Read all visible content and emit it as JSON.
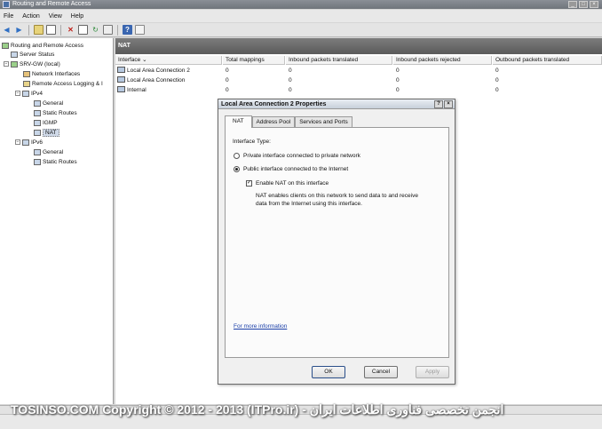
{
  "window": {
    "title": "Routing and Remote Access"
  },
  "menu": [
    "File",
    "Action",
    "View",
    "Help"
  ],
  "toolbar": {
    "icons": [
      "back-icon",
      "forward-icon",
      "up-icon",
      "properties-icon",
      "delete-icon",
      "export-icon",
      "refresh-icon",
      "help-icon",
      "console-icon"
    ]
  },
  "tree": {
    "items": [
      {
        "label": "Routing and Remote Access"
      },
      {
        "label": "Server Status"
      },
      {
        "label": "SRV-GW (local)"
      },
      {
        "label": "Network Interfaces"
      },
      {
        "label": "Remote Access Logging & I"
      },
      {
        "label": "IPv4"
      },
      {
        "label": "General"
      },
      {
        "label": "Static Routes"
      },
      {
        "label": "IGMP"
      },
      {
        "label": "NAT"
      },
      {
        "label": "IPv6"
      },
      {
        "label": "General"
      },
      {
        "label": "Static Routes"
      }
    ]
  },
  "nat": {
    "heading": "NAT",
    "columns": [
      "Interface",
      "Total mappings",
      "Inbound packets translated",
      "Inbound packets rejected",
      "Outbound packets translated"
    ],
    "rows": [
      {
        "name": "Local Area Connection 2",
        "total": "0",
        "in_trans": "0",
        "in_rej": "0",
        "out_trans": "0"
      },
      {
        "name": "Local Area Connection",
        "total": "0",
        "in_trans": "0",
        "in_rej": "0",
        "out_trans": "0"
      },
      {
        "name": "Internal",
        "total": "0",
        "in_trans": "0",
        "in_rej": "0",
        "out_trans": "0"
      }
    ]
  },
  "dialog": {
    "title": "Local Area Connection 2 Properties",
    "tabs": [
      "NAT",
      "Address Pool",
      "Services and Ports"
    ],
    "interface_type_label": "Interface Type:",
    "radio_private": "Private interface connected to private network",
    "radio_public": "Public interface connected to the Internet",
    "enable_nat": "Enable NAT on this interface",
    "nat_note_1": "NAT enables clients on this network to send data to and receive",
    "nat_note_2": "data from the Internet using this interface.",
    "more_info": "For more information",
    "ok": "OK",
    "cancel": "Cancel",
    "apply": "Apply"
  },
  "watermark": "TOSINSO.COM   Copyright © 2012 - 2013 (ITPro.ir) - انجمن تخصصی فناوری اطلاعات ایران"
}
